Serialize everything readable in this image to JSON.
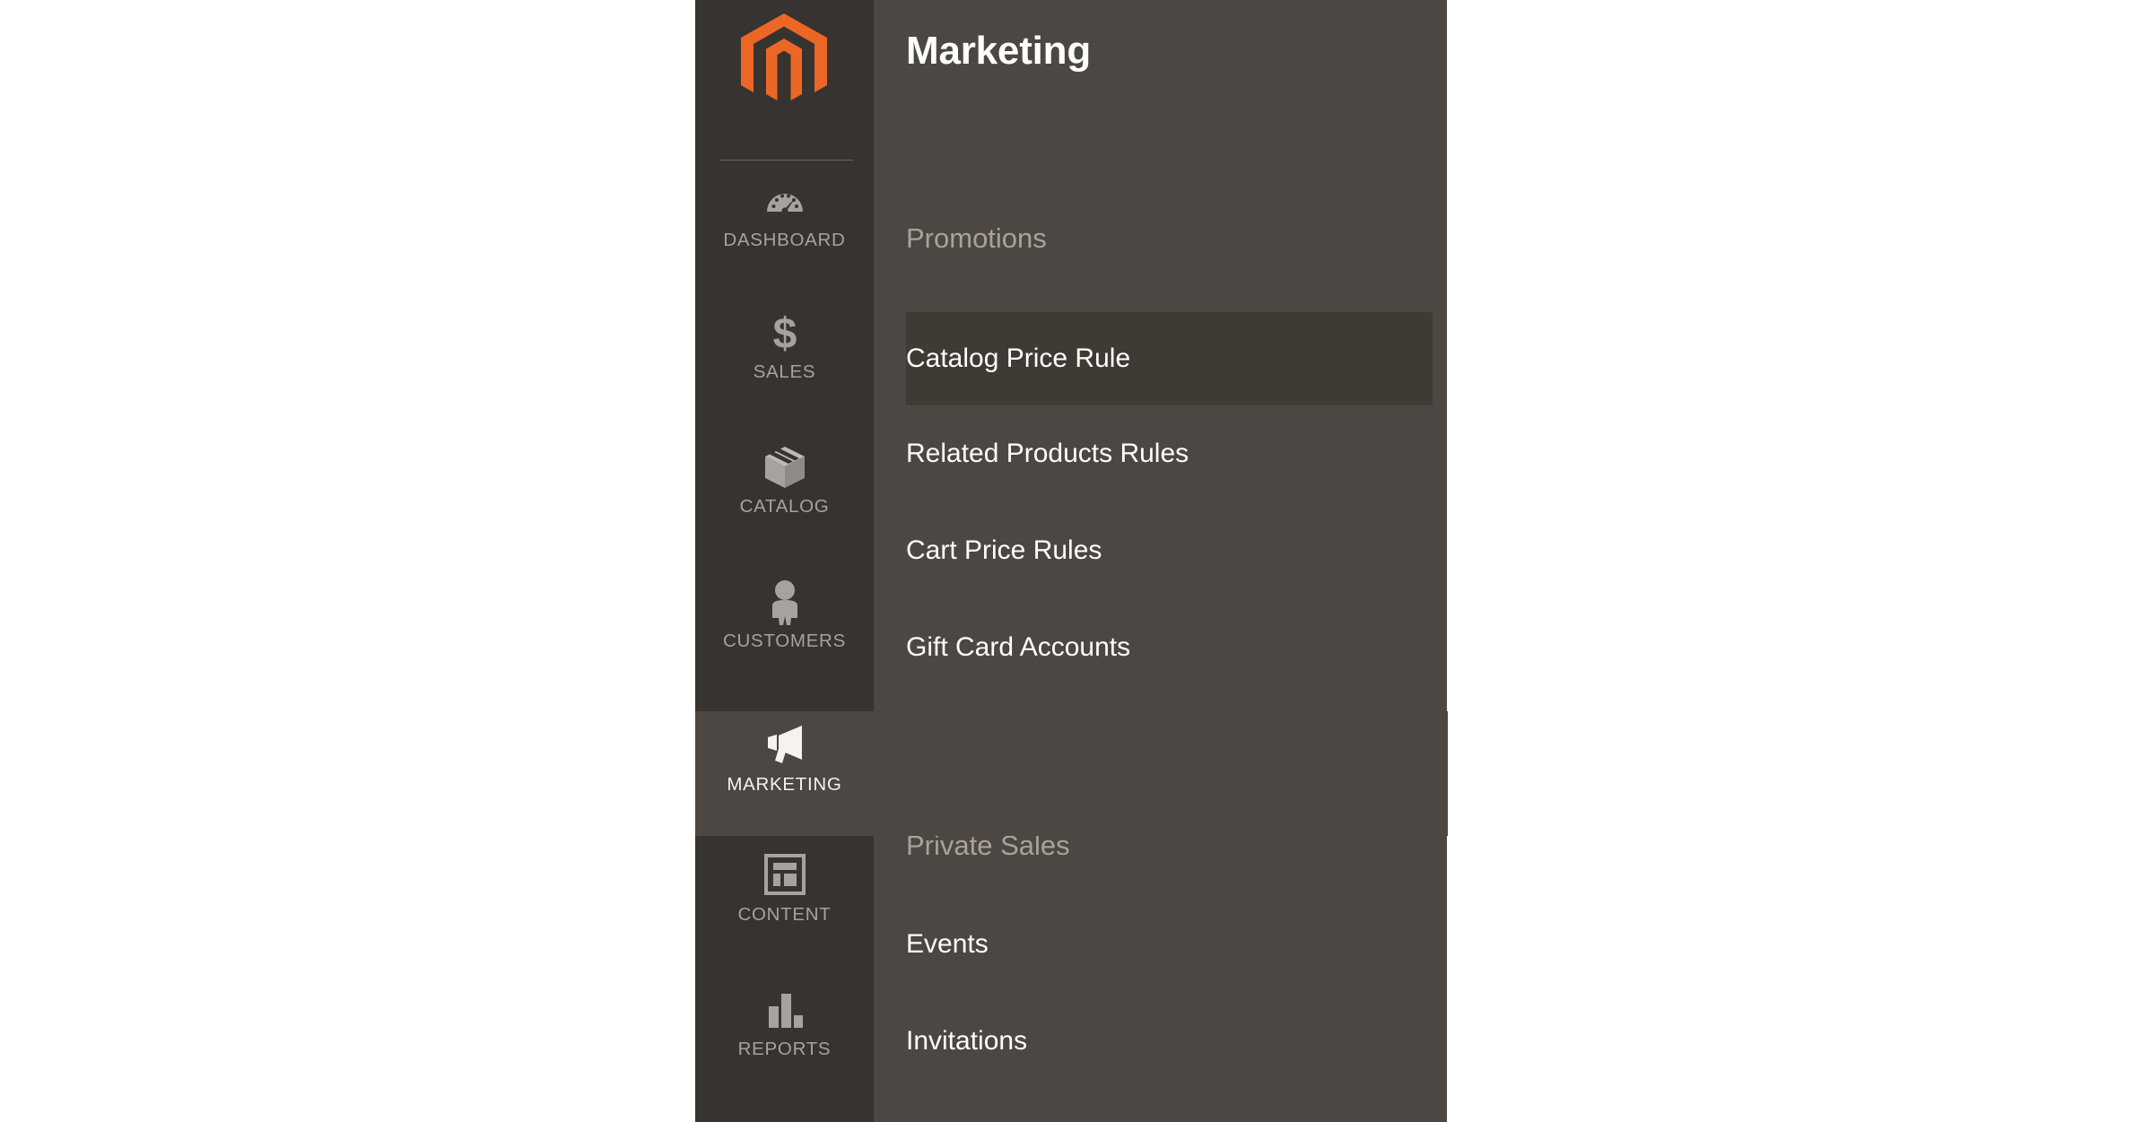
{
  "theme": {
    "sidebar_bg": "#373330",
    "flyout_bg": "#4c4742",
    "active_item_bg": "#4c4742",
    "current_subitem_bg": "#403a35",
    "icon_color": "#a6a29e",
    "label_color": "#a6a29e",
    "active_label_color": "#f5f2ef",
    "group_title_color": "#a9a29b",
    "logo_orange": "#ec6726",
    "divider_color": "#6d6762",
    "page_bg": "#ffffff"
  },
  "sidebar": {
    "logo": {
      "name": "magento-logo",
      "alt": "Magento"
    },
    "items": [
      {
        "label": "DASHBOARD",
        "icon": "gauge-icon",
        "active": false
      },
      {
        "label": "SALES",
        "icon": "dollar-icon",
        "active": false
      },
      {
        "label": "CATALOG",
        "icon": "box-icon",
        "active": false
      },
      {
        "label": "CUSTOMERS",
        "icon": "person-icon",
        "active": false
      },
      {
        "label": "MARKETING",
        "icon": "megaphone-icon",
        "active": true
      },
      {
        "label": "CONTENT",
        "icon": "layout-icon",
        "active": false
      },
      {
        "label": "REPORTS",
        "icon": "bar-chart-icon",
        "active": false
      }
    ]
  },
  "flyout": {
    "title": "Marketing",
    "groups": [
      {
        "title": "Promotions",
        "items": [
          {
            "label": "Catalog Price Rule",
            "current": true
          },
          {
            "label": "Related Products Rules",
            "current": false
          },
          {
            "label": "Cart Price Rules",
            "current": false
          },
          {
            "label": "Gift Card Accounts",
            "current": false
          }
        ]
      },
      {
        "title": "Private Sales",
        "items": [
          {
            "label": "Events",
            "current": false
          },
          {
            "label": "Invitations",
            "current": false
          }
        ]
      }
    ]
  }
}
